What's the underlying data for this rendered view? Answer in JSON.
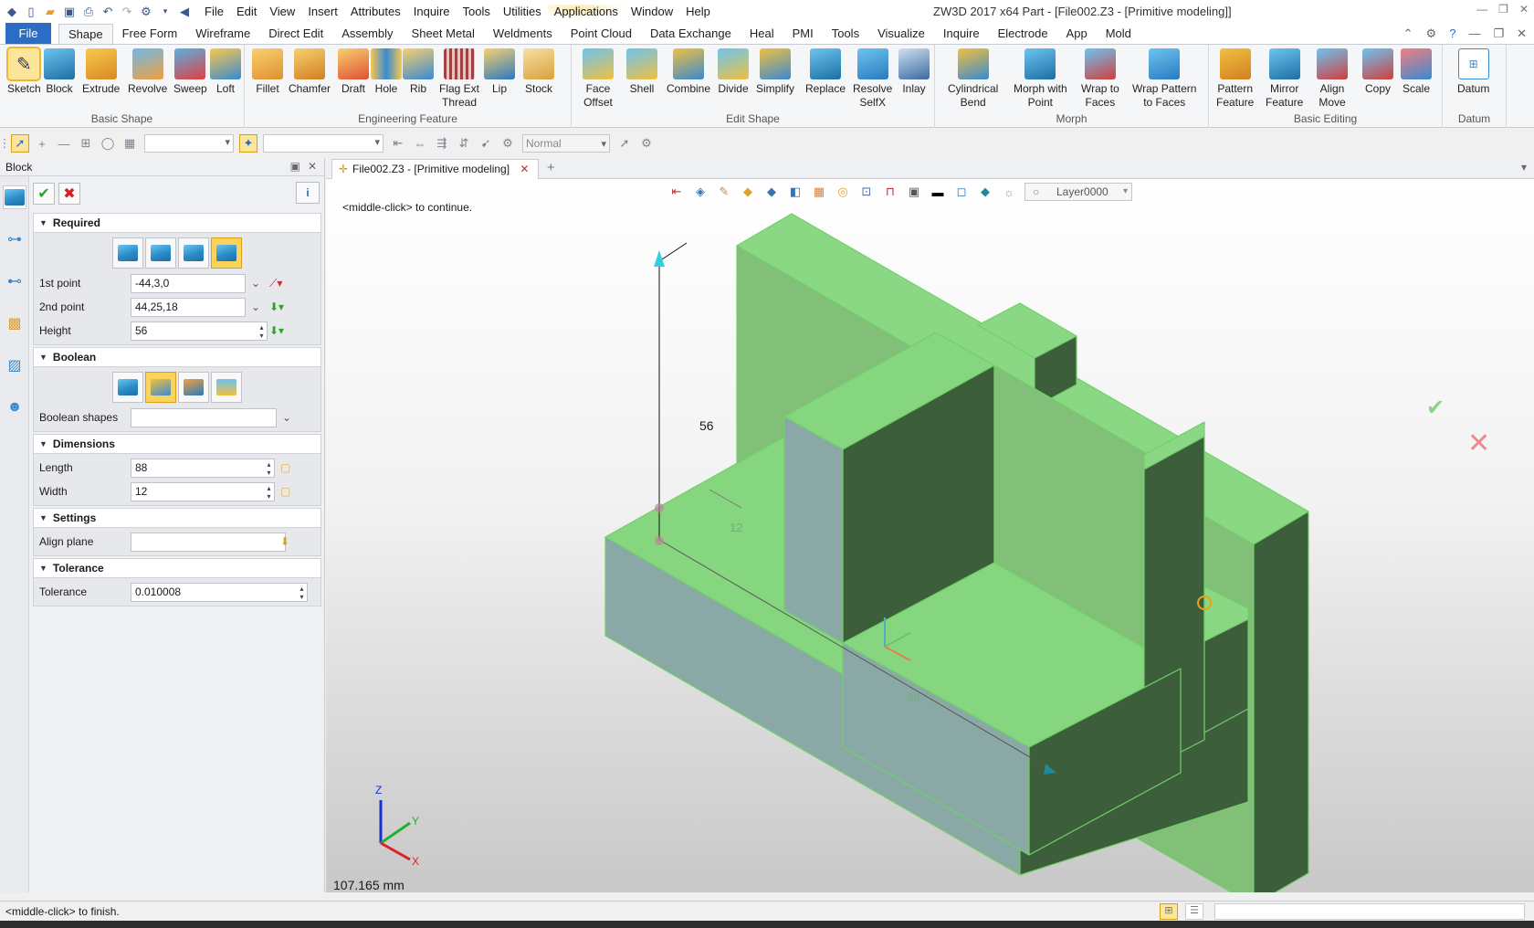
{
  "titlebar": {
    "menus": [
      "File",
      "Edit",
      "View",
      "Insert",
      "Attributes",
      "Inquire",
      "Tools",
      "Utilities",
      "Applications",
      "Window",
      "Help"
    ],
    "title": "ZW3D 2017  x64      Part - [File002.Z3 - [Primitive modeling]]"
  },
  "ribbon_tabs": {
    "file": "File",
    "tabs": [
      "Shape",
      "Free Form",
      "Wireframe",
      "Direct Edit",
      "Assembly",
      "Sheet Metal",
      "Weldments",
      "Point Cloud",
      "Data Exchange",
      "Heal",
      "PMI",
      "Tools",
      "Visualize",
      "Inquire",
      "Electrode",
      "App",
      "Mold"
    ]
  },
  "ribbon": {
    "basic_shape": {
      "label": "Basic Shape",
      "buttons": [
        "Sketch",
        "Block",
        "Extrude",
        "Revolve",
        "Sweep",
        "Loft"
      ]
    },
    "engineering_feature": {
      "label": "Engineering Feature",
      "buttons": [
        "Fillet",
        "Chamfer",
        "Draft",
        "Hole",
        "Rib",
        "Flag Ext\nThread",
        "Lip",
        "Stock"
      ]
    },
    "edit_shape": {
      "label": "Edit Shape",
      "buttons": [
        "Face\nOffset",
        "Shell",
        "Combine",
        "Divide",
        "Simplify",
        "Replace",
        "Resolve\nSelfX",
        "Inlay"
      ]
    },
    "morph": {
      "label": "Morph",
      "buttons": [
        "Cylindrical\nBend",
        "Morph with\nPoint",
        "Wrap to\nFaces",
        "Wrap Pattern\nto Faces"
      ]
    },
    "basic_editing": {
      "label": "Basic Editing",
      "buttons": [
        "Pattern\nFeature",
        "Mirror\nFeature",
        "Align\nMove",
        "Copy",
        "Scale"
      ]
    },
    "datum": {
      "label": "Datum",
      "buttons": [
        "Datum"
      ]
    }
  },
  "toolbar2": {
    "mode": "Normal"
  },
  "panel": {
    "title": "Block",
    "required": {
      "header": "Required",
      "first_point_label": "1st point",
      "first_point": "-44,3,0",
      "second_point_label": "2nd point",
      "second_point": "44,25,18",
      "height_label": "Height",
      "height": "56"
    },
    "boolean": {
      "header": "Boolean",
      "shapes_label": "Boolean shapes",
      "shapes": ""
    },
    "dimensions": {
      "header": "Dimensions",
      "length_label": "Length",
      "length": "88",
      "width_label": "Width",
      "width": "12"
    },
    "settings": {
      "header": "Settings",
      "align_label": "Align plane",
      "align": ""
    },
    "tolerance": {
      "header": "Tolerance",
      "tol_label": "Tolerance",
      "tol": "0.010008"
    }
  },
  "doc_tab": "File002.Z3 - [Primitive modeling]",
  "viewport": {
    "prompt": "<middle-click> to continue.",
    "layer": "Layer0000",
    "dim_height": "56",
    "dim_width": "12",
    "dim_length": "88",
    "axis_z": "Z",
    "axis_y": "Y",
    "axis_x": "X",
    "measure": "107.165 mm",
    "colors": {
      "model_face": "#86d67f",
      "model_side": "#8aa9a6",
      "model_dark": "#3a5e3a",
      "edge": "#68c860"
    }
  },
  "status": {
    "text": "<middle-click> to finish."
  }
}
